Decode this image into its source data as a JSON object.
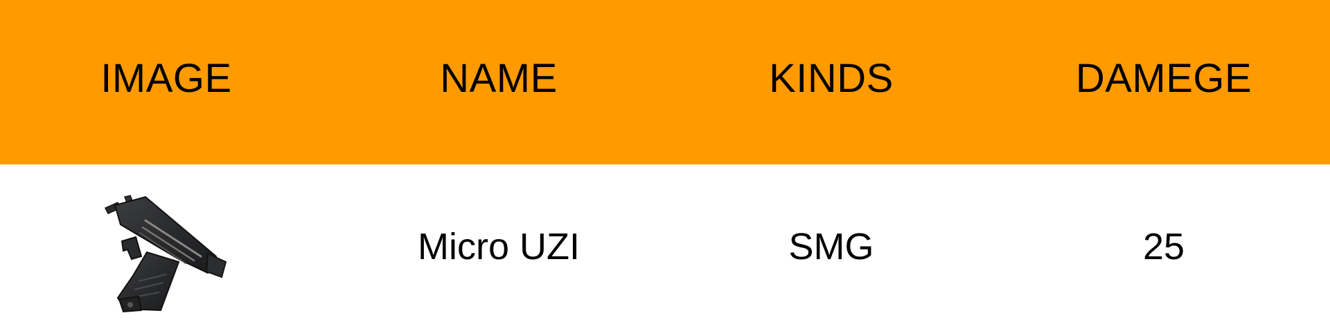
{
  "table": {
    "headers": {
      "image": "IMAGE",
      "name": "NAME",
      "kinds": "KINDS",
      "damage": "DAMEGE"
    },
    "rows": [
      {
        "image_icon": "uzi-gun-icon",
        "name": "Micro UZI",
        "kind": "SMG",
        "damage": "25"
      }
    ]
  },
  "colors": {
    "header_background": "#ff9a00",
    "body_background": "#ffffff",
    "text": "#000000"
  }
}
